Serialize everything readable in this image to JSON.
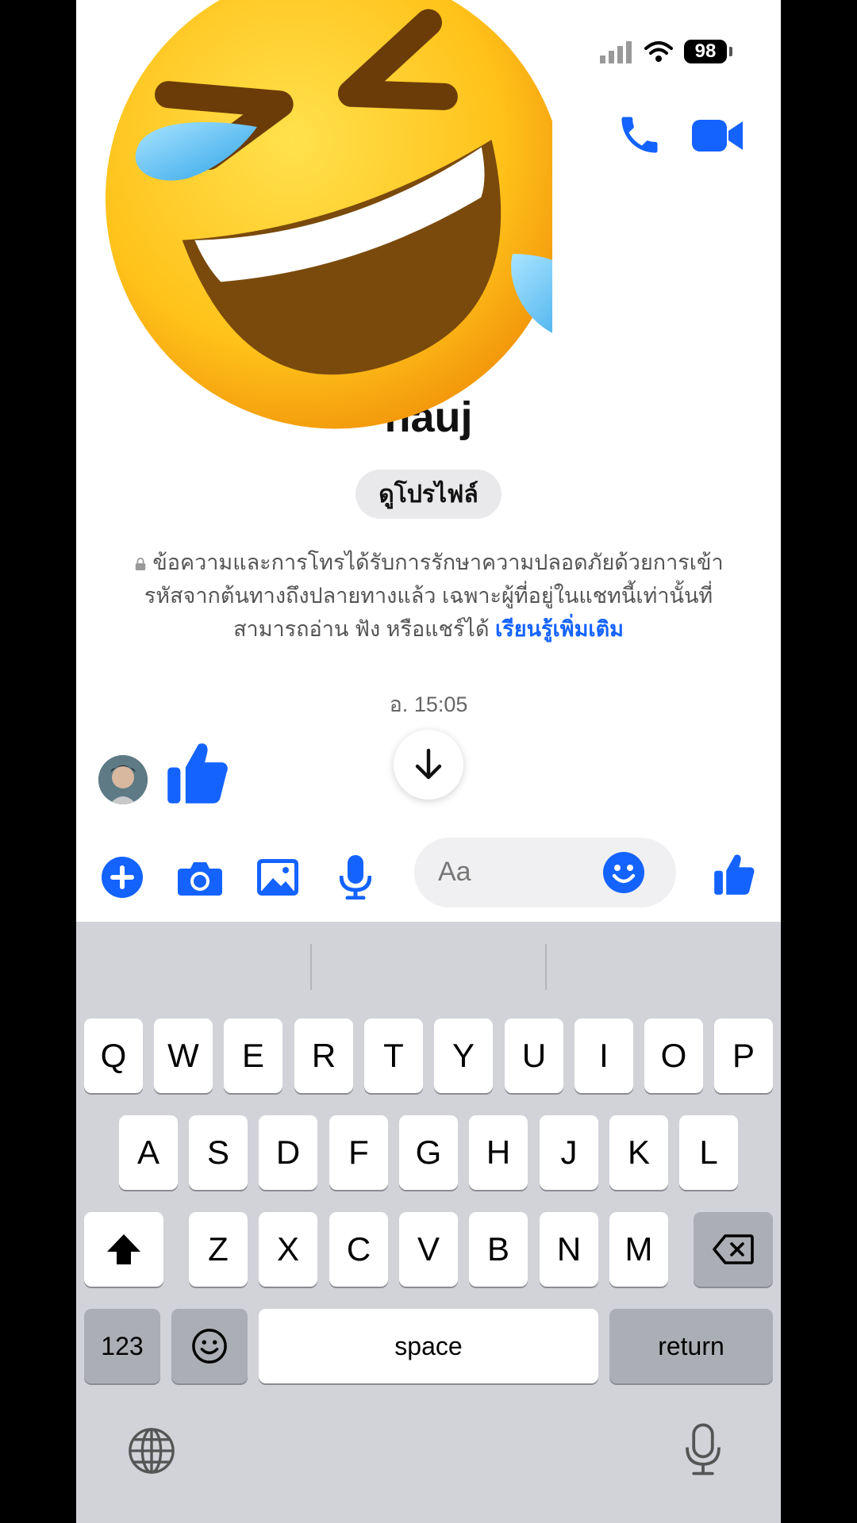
{
  "status_bar": {
    "battery": "98"
  },
  "conversation": {
    "contact_name": "hauj",
    "view_profile_label": "ดูโปรไฟล์",
    "e2ee_notice": "ข้อความและการโทรได้รับการรักษาความปลอดภัยด้วยการเข้ารหัสจากต้นทางถึงปลายทางแล้ว เฉพาะผู้ที่อยู่ในแชทนี้เท่านั้นที่สามารถอ่าน ฟัง หรือแชร์ได้",
    "learn_more": "เรียนรู้เพิ่มเติม",
    "timestamp": "อ. 15:05"
  },
  "composer": {
    "placeholder": "Aa"
  },
  "keyboard": {
    "row1": [
      "Q",
      "W",
      "E",
      "R",
      "T",
      "Y",
      "U",
      "I",
      "O",
      "P"
    ],
    "row2": [
      "A",
      "S",
      "D",
      "F",
      "G",
      "H",
      "J",
      "K",
      "L"
    ],
    "row3": [
      "Z",
      "X",
      "C",
      "V",
      "B",
      "N",
      "M"
    ],
    "numbers_label": "123",
    "space_label": "space",
    "return_label": "return"
  },
  "colors": {
    "accent": "#1463ff",
    "keyboard_bg": "#d1d3d9"
  }
}
